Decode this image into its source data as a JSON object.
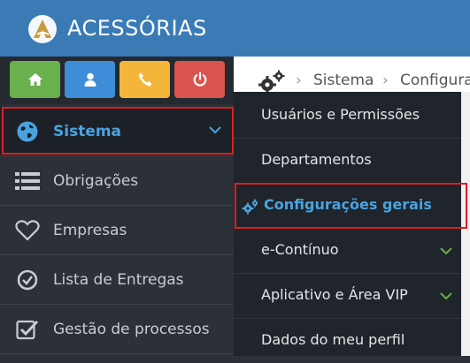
{
  "header": {
    "title": "ACESSÓRIAS"
  },
  "shortcuts": [
    {
      "icon": "home-icon",
      "color": "#6ab04c"
    },
    {
      "icon": "user-icon",
      "color": "#3d8dd8"
    },
    {
      "icon": "phone-icon",
      "color": "#f4b63a"
    },
    {
      "icon": "power-icon",
      "color": "#d9534f"
    }
  ],
  "sidebar": {
    "items": [
      {
        "label": "Sistema",
        "icon": "globe-icon",
        "active": true
      },
      {
        "label": "Obrigações",
        "icon": "list-icon"
      },
      {
        "label": "Empresas",
        "icon": "heart-icon"
      },
      {
        "label": "Lista de Entregas",
        "icon": "check-circle-icon"
      },
      {
        "label": "Gestão de processos",
        "icon": "check-square-icon"
      }
    ]
  },
  "breadcrumb": {
    "items": [
      "Sistema",
      "Configura"
    ]
  },
  "submenu": {
    "items": [
      {
        "label": "Usuários e Permissões"
      },
      {
        "label": "Departamentos"
      },
      {
        "label": "Configurações gerais",
        "active": true
      },
      {
        "label": "e-Contínuo",
        "has_children": true
      },
      {
        "label": "Aplicativo e Área VIP",
        "has_children": true
      },
      {
        "label": "Dados do meu perfil"
      }
    ]
  },
  "colors": {
    "accent": "#4aa3e0",
    "highlight": "#e01d22",
    "topbar": "#3a7bb6",
    "chevron_green": "#6ab04c"
  }
}
